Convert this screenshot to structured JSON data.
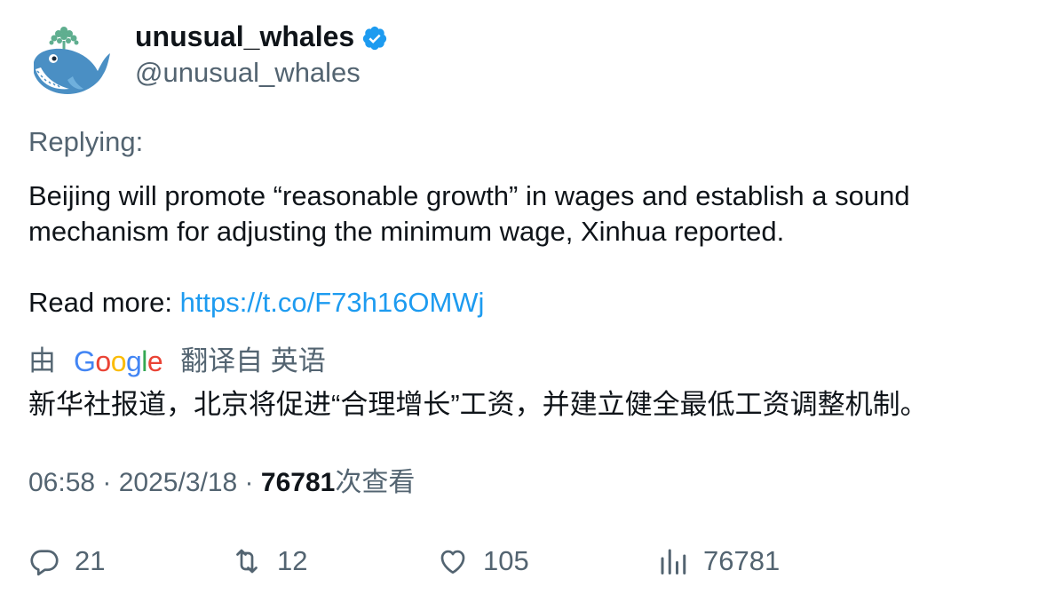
{
  "author": {
    "display_name": "unusual_whales",
    "handle": "@unusual_whales",
    "avatar_icon": "whale-icon",
    "verified_icon": "verified-badge-icon"
  },
  "replying": "Replying:",
  "tweet": {
    "text_line": "Beijing will promote “reasonable growth” in wages and establish a sound mechanism for adjusting the minimum wage, Xinhua reported.",
    "read_more_prefix": "Read more: ",
    "link": "https://t.co/F73h16OMWj"
  },
  "translation": {
    "by_prefix": "由",
    "google_letters": [
      "G",
      "o",
      "o",
      "g",
      "l",
      "e"
    ],
    "suffix": "翻译自 英语",
    "text": "新华社报道，北京将促进“合理增长”工资，并建立健全最低工资调整机制。"
  },
  "meta": {
    "time": "06:58",
    "separator": " · ",
    "date": "2025/3/18",
    "views_count": "76781",
    "views_label": "次查看"
  },
  "actions": {
    "reply": {
      "icon": "reply-icon",
      "count": "21"
    },
    "retweet": {
      "icon": "retweet-icon",
      "count": "12"
    },
    "like": {
      "icon": "heart-icon",
      "count": "105"
    },
    "views": {
      "icon": "views-chart-icon",
      "count": "76781"
    }
  },
  "colors": {
    "link": "#1d9bf0",
    "secondary_text": "#536471",
    "primary_text": "#0f1419",
    "verified": "#1d9bf0",
    "google_blue": "#4285F4",
    "google_red": "#EA4335",
    "google_yellow": "#FBBC05",
    "google_green": "#34A853"
  }
}
